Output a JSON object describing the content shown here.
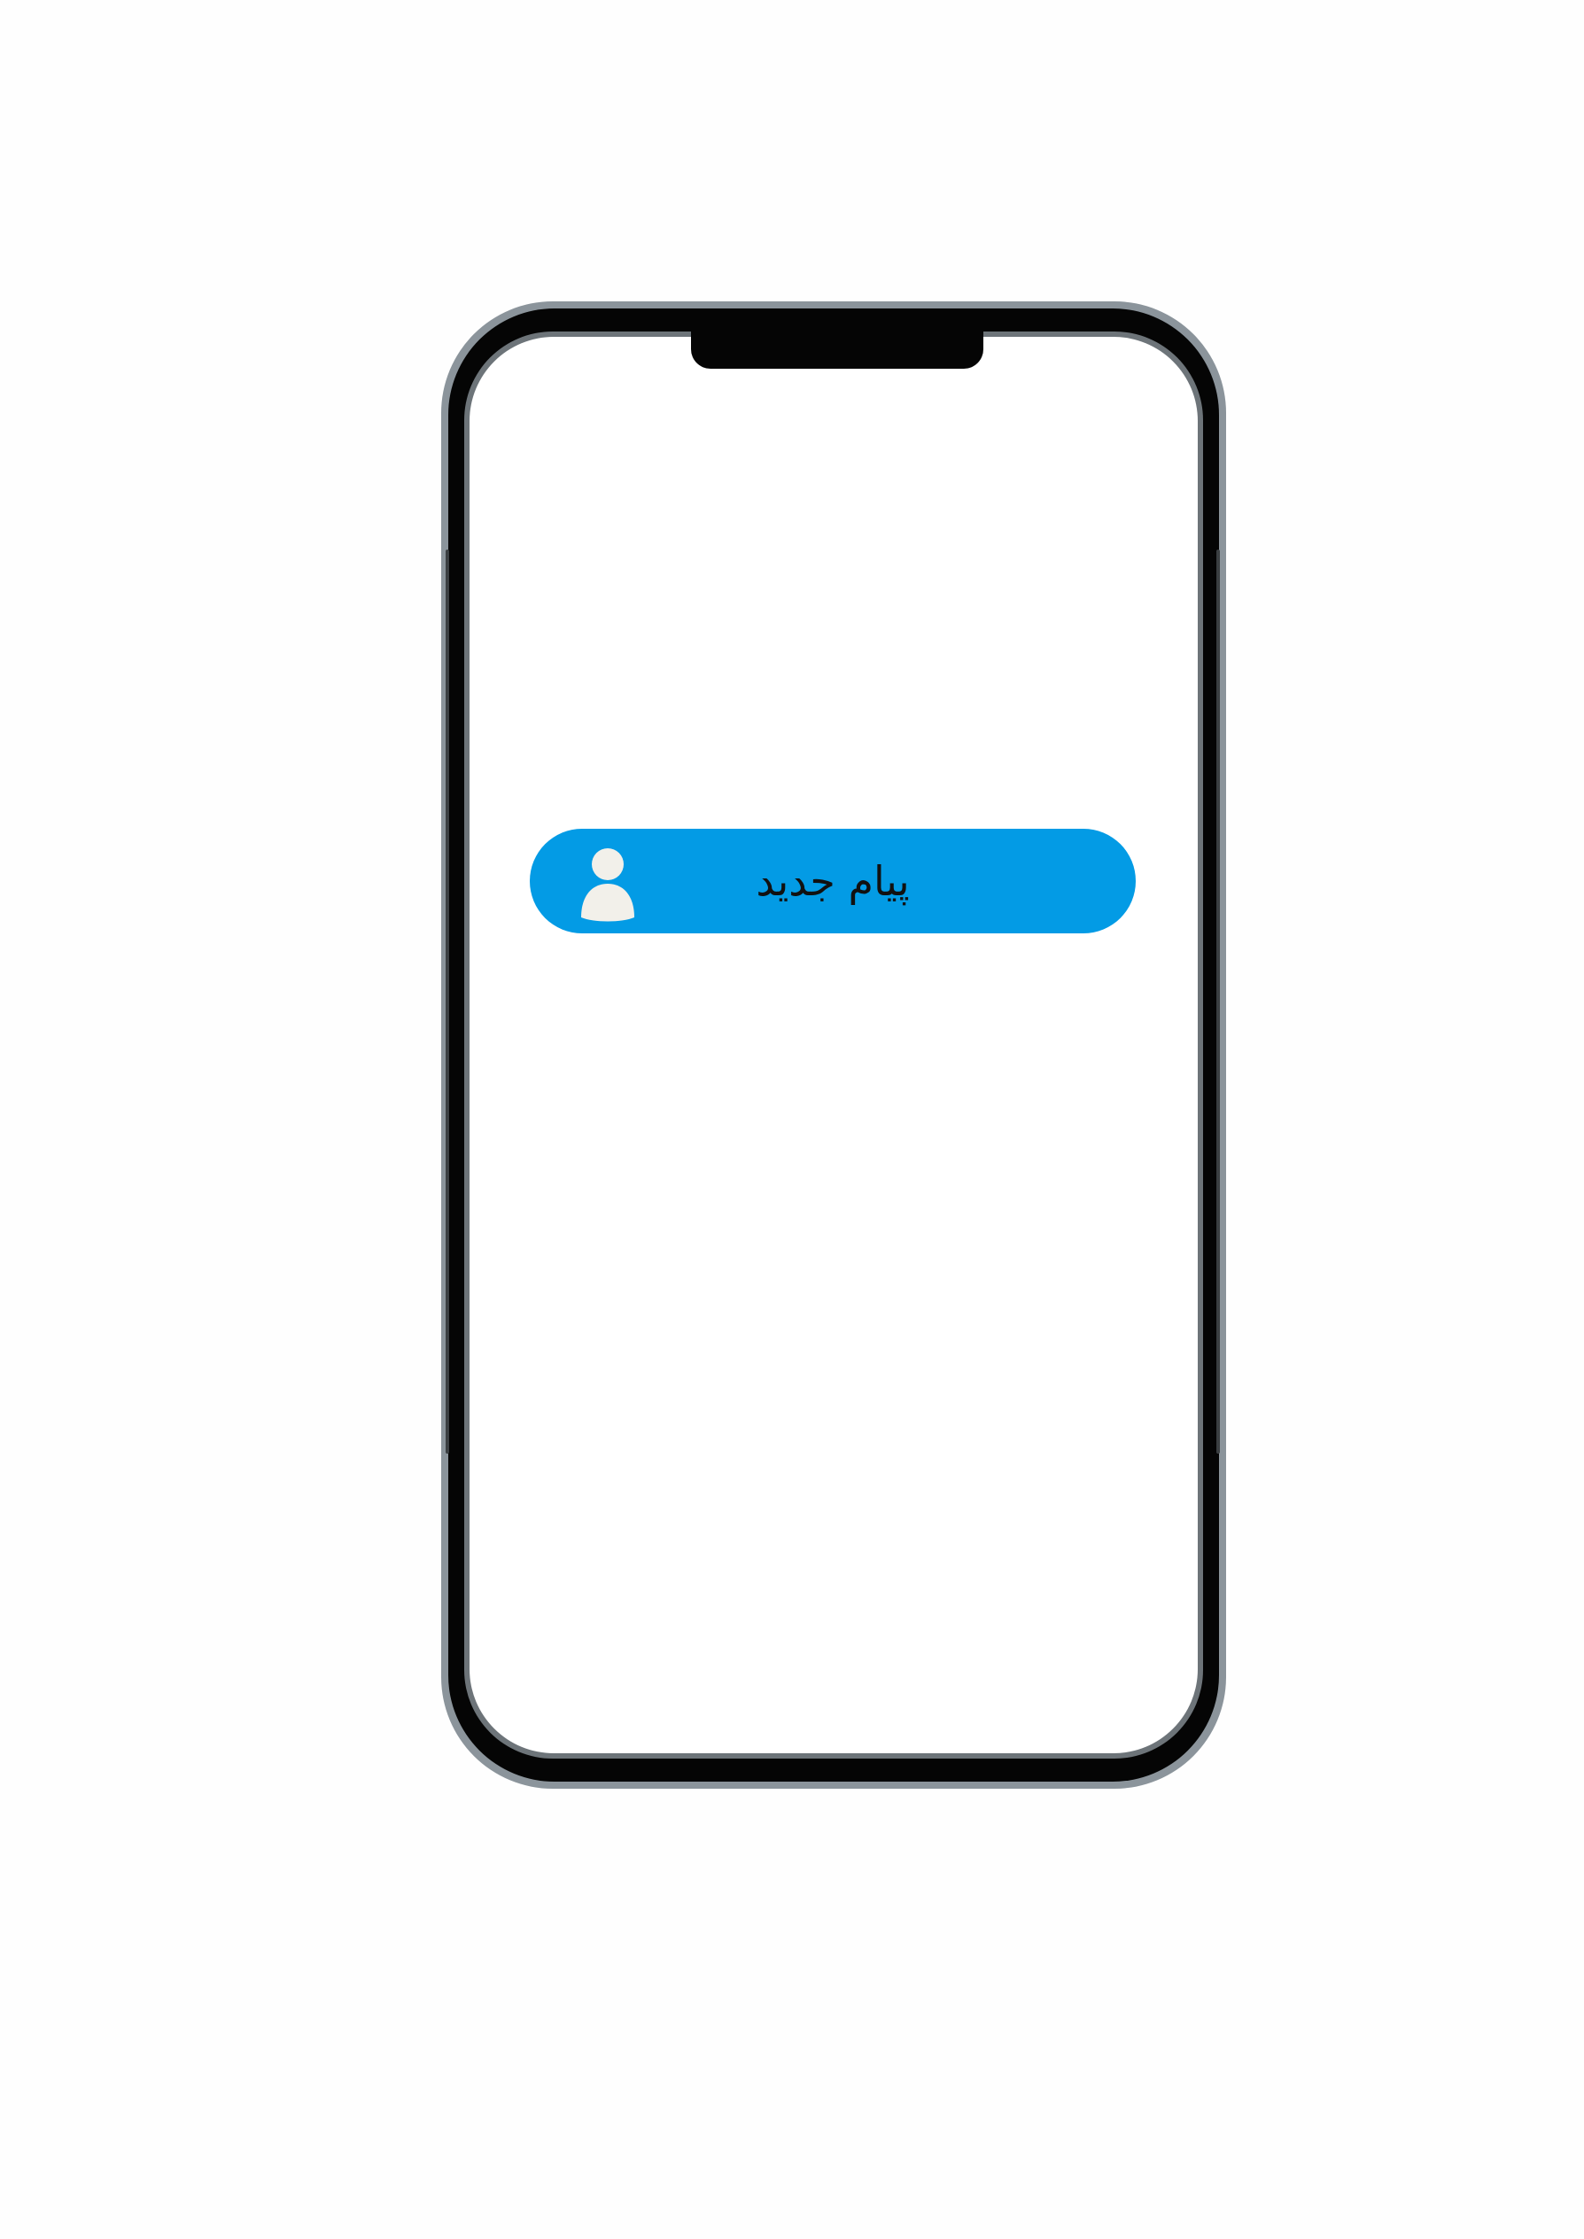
{
  "notification": {
    "text": "پیام جدید",
    "avatar_icon": "user-avatar-icon",
    "background_color": "#039be5",
    "text_color": "#111111",
    "avatar_color": "#f2f0ea"
  },
  "device": {
    "frame_color": "#050505",
    "rim_color": "#8b949b",
    "screen_color": "#ffffff"
  }
}
